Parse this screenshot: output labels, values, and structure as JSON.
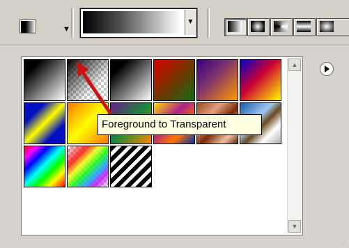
{
  "toolbar": {
    "tool_preset_icon": "gradient-tool-icon",
    "preset_arrow": "▼",
    "gradient_dropdown_arrow": "▼",
    "gradient_type_icons": [
      "linear-gradient-icon",
      "radial-gradient-icon",
      "angle-gradient-icon",
      "reflected-gradient-icon",
      "diamond-gradient-icon"
    ]
  },
  "picker": {
    "menu_icon": "panel-menu-icon",
    "swatches": [
      {
        "name": "Foreground to Background"
      },
      {
        "name": "Foreground to Transparent"
      },
      {
        "name": "Black, White"
      },
      {
        "name": "Red, Green"
      },
      {
        "name": "Violet, Orange"
      },
      {
        "name": "Blue, Red, Yellow"
      },
      {
        "name": "Blue, Yellow, Blue"
      },
      {
        "name": "Orange, Yellow, Orange"
      },
      {
        "name": "Violet, Green, Orange"
      },
      {
        "name": "Yellow, Violet, Orange, Blue"
      },
      {
        "name": "Copper"
      },
      {
        "name": "Chrome"
      },
      {
        "name": "Spectrum"
      },
      {
        "name": "Transparent Rainbow"
      },
      {
        "name": "Transparent Stripes"
      }
    ],
    "tooltip": "Foreground to Transparent"
  },
  "colors": {
    "annotation_arrow": "#cc1111",
    "tooltip_bg": "#ffffe1"
  }
}
